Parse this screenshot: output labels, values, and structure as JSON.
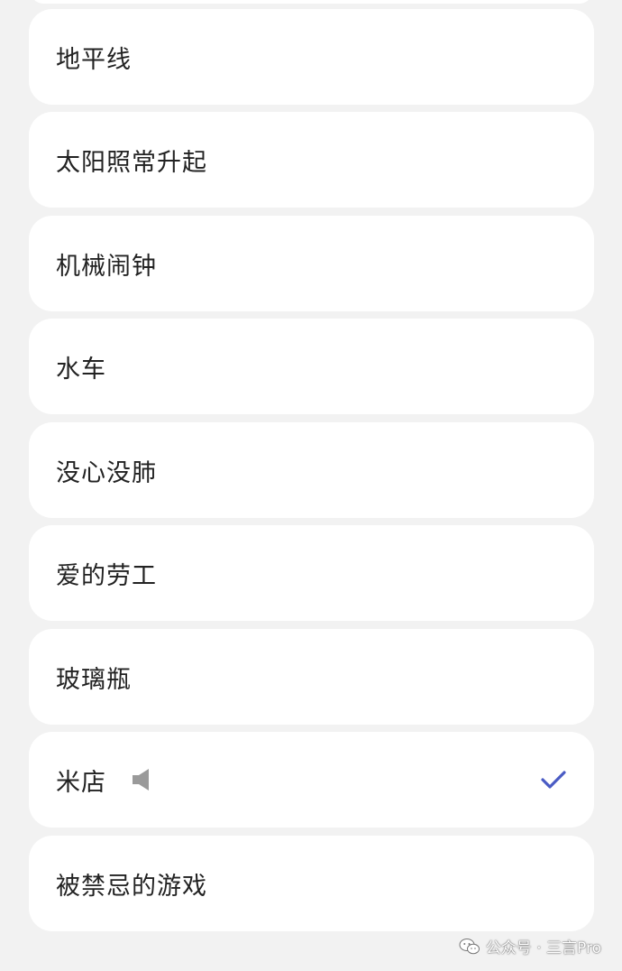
{
  "colors": {
    "background": "#f2f2f2",
    "card": "#ffffff",
    "text": "#222222",
    "accent": "#4a5bc4",
    "speaker": "#9a9a9a"
  },
  "list": {
    "items": [
      {
        "label": "地平线"
      },
      {
        "label": "太阳照常升起"
      },
      {
        "label": "机械闹钟"
      },
      {
        "label": "水车"
      },
      {
        "label": "没心没肺"
      },
      {
        "label": "爱的劳工"
      },
      {
        "label": "玻璃瓶"
      },
      {
        "label": "米店",
        "selected": true,
        "playing_icon": "speaker-icon",
        "selected_icon": "checkmark-icon"
      },
      {
        "label": "被禁忌的游戏"
      }
    ]
  },
  "watermark": {
    "icon": "wechat-icon",
    "text": "公众号 · 三言Pro"
  }
}
